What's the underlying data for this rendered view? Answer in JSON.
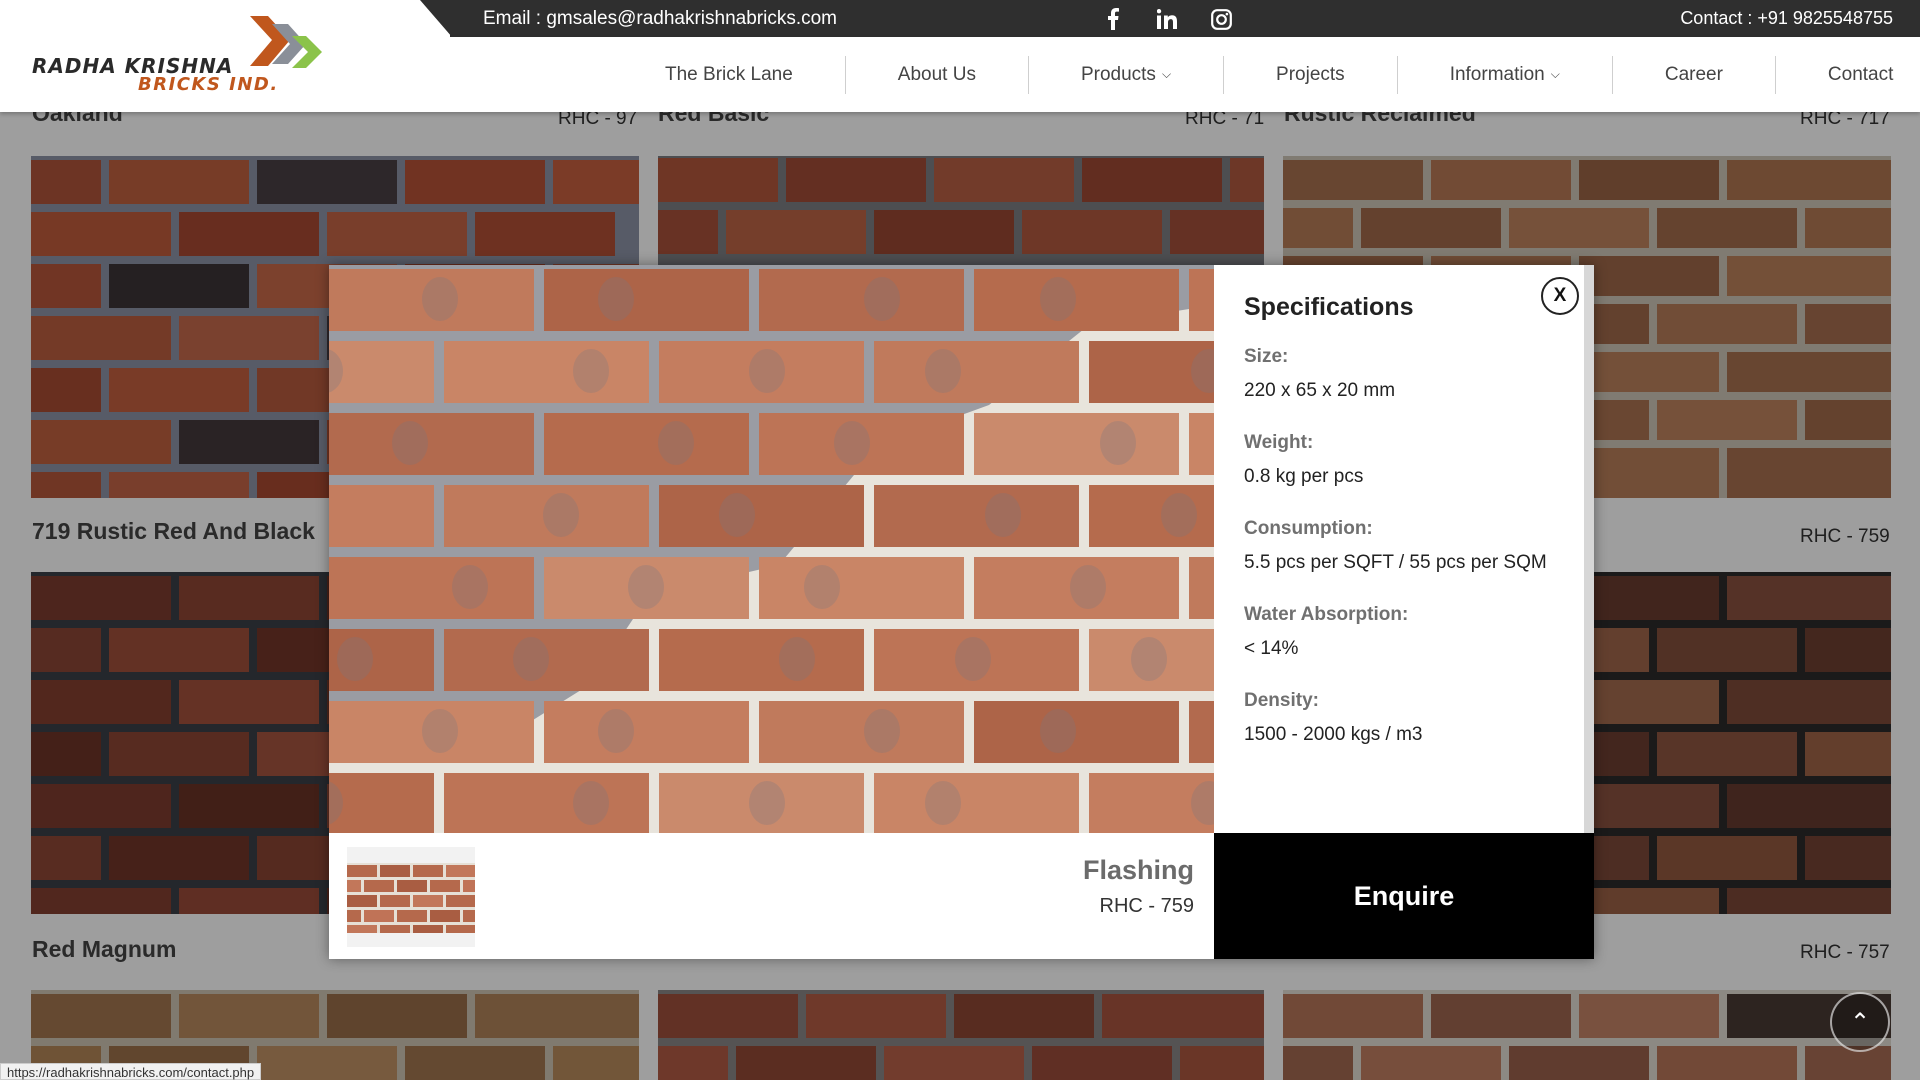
{
  "header": {
    "email": "Email : gmsales@radhakrishnabricks.com",
    "contact": "Contact : +91 9825548755",
    "logo_line1": "RADHA KRISHNA",
    "logo_line2": "BRICKS IND.",
    "social": [
      "facebook-icon",
      "linkedin-icon",
      "instagram-icon"
    ]
  },
  "nav": {
    "items": [
      {
        "label": "The Brick Lane",
        "dropdown": false
      },
      {
        "label": "About Us",
        "dropdown": false
      },
      {
        "label": "Products",
        "dropdown": true
      },
      {
        "label": "Projects",
        "dropdown": false
      },
      {
        "label": "Information",
        "dropdown": true
      },
      {
        "label": "Career",
        "dropdown": false
      },
      {
        "label": "Contact",
        "dropdown": false
      }
    ]
  },
  "grid": {
    "row1": [
      {
        "title": "Oakland",
        "code": "RHC - 97"
      },
      {
        "title": "Red Basic",
        "code": "RHC - 71"
      },
      {
        "title": "Rustic Reclaimed",
        "code": "RHC - 717"
      }
    ],
    "row2": [
      {
        "title": "719 Rustic Red And Black",
        "code": ""
      },
      {
        "title": "",
        "code": "RHC - 759"
      }
    ],
    "row3": [
      {
        "title": "Red Magnum",
        "code": ""
      },
      {
        "title": "",
        "code": "RHC - 757"
      }
    ]
  },
  "modal": {
    "spec_title": "Specifications",
    "close_label": "X",
    "specs": [
      {
        "label": "Size:",
        "value": "220 x 65 x 20 mm"
      },
      {
        "label": "Weight:",
        "value": "0.8 kg per pcs"
      },
      {
        "label": "Consumption:",
        "value": "5.5 pcs per SQFT / 55 pcs per SQM"
      },
      {
        "label": "Water Absorption:",
        "value": "< 14%"
      },
      {
        "label": "Density:",
        "value": "1500 - 2000 kgs / m3"
      }
    ],
    "product_name": "Flashing",
    "product_code": "RHC - 759",
    "enquire_label": "Enquire"
  },
  "status_url": "https://radhakrishnabricks.com/contact.php",
  "colors": {
    "brick_main": "#b8694a",
    "mortar_light": "#e9e6df",
    "mortar_grey": "#8d8f94",
    "logo_orange": "#c0571d",
    "logo_green": "#8bc34a"
  }
}
